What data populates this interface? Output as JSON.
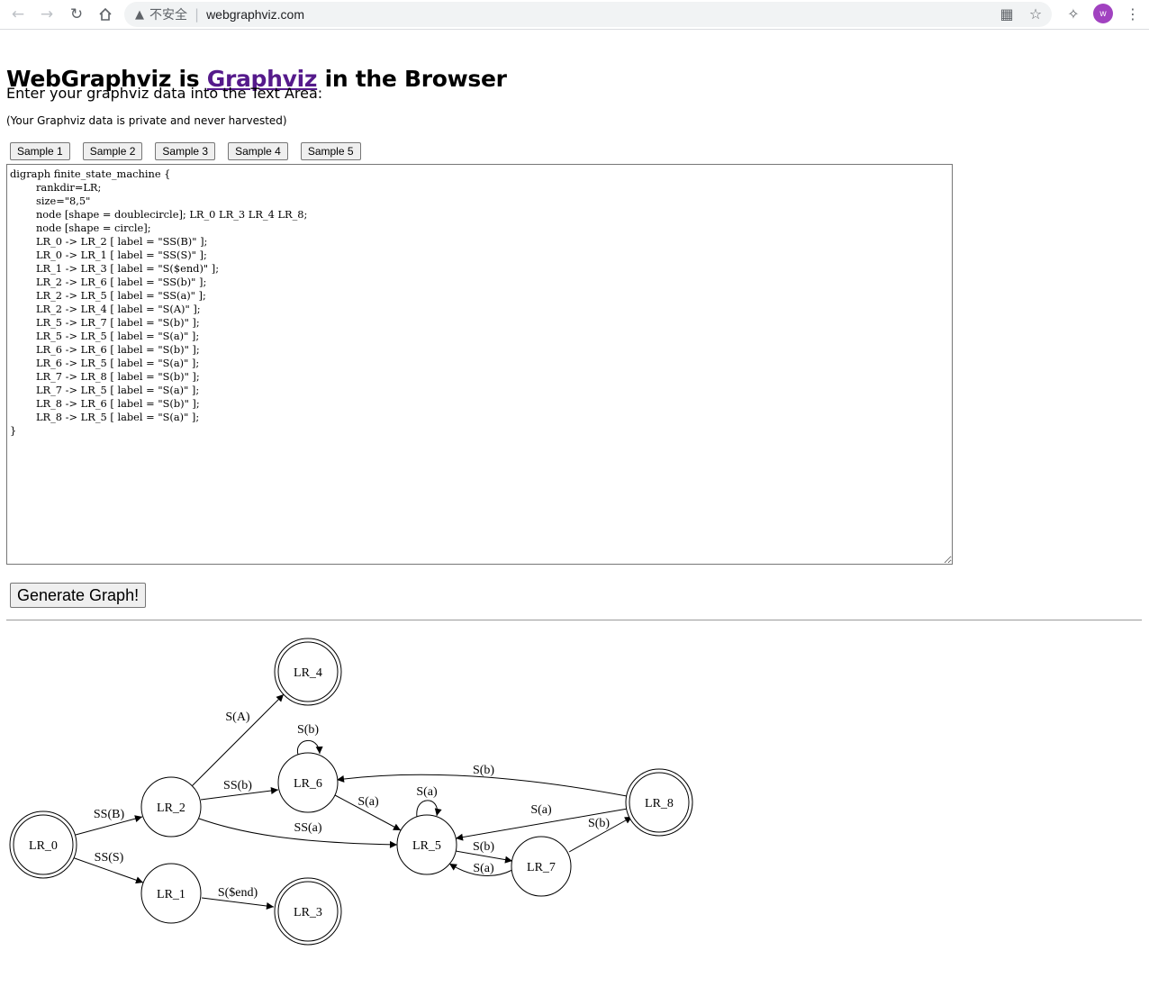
{
  "browser": {
    "insecure_label": "不安全",
    "url": "webgraphviz.com",
    "avatar_letter": "w"
  },
  "header": {
    "title_prefix": "WebGraphviz is ",
    "title_link": "Graphviz",
    "title_suffix": " in the Browser"
  },
  "intro_text": "Enter your graphviz data into the Text Area:",
  "privacy_text": "(Your Graphviz data is private and never harvested)",
  "samples": [
    "Sample 1",
    "Sample 2",
    "Sample 3",
    "Sample 4",
    "Sample 5"
  ],
  "editor": {
    "content": "digraph finite_state_machine {\n\trankdir=LR;\n\tsize=\"8,5\"\n\tnode [shape = doublecircle]; LR_0 LR_3 LR_4 LR_8;\n\tnode [shape = circle];\n\tLR_0 -> LR_2 [ label = \"SS(B)\" ];\n\tLR_0 -> LR_1 [ label = \"SS(S)\" ];\n\tLR_1 -> LR_3 [ label = \"S($end)\" ];\n\tLR_2 -> LR_6 [ label = \"SS(b)\" ];\n\tLR_2 -> LR_5 [ label = \"SS(a)\" ];\n\tLR_2 -> LR_4 [ label = \"S(A)\" ];\n\tLR_5 -> LR_7 [ label = \"S(b)\" ];\n\tLR_5 -> LR_5 [ label = \"S(a)\" ];\n\tLR_6 -> LR_6 [ label = \"S(b)\" ];\n\tLR_6 -> LR_5 [ label = \"S(a)\" ];\n\tLR_7 -> LR_8 [ label = \"S(b)\" ];\n\tLR_7 -> LR_5 [ label = \"S(a)\" ];\n\tLR_8 -> LR_6 [ label = \"S(b)\" ];\n\tLR_8 -> LR_5 [ label = \"S(a)\" ];\n}"
  },
  "generate_button": "Generate Graph!",
  "graph": {
    "nodes": {
      "LR_0": "LR_0",
      "LR_1": "LR_1",
      "LR_2": "LR_2",
      "LR_3": "LR_3",
      "LR_4": "LR_4",
      "LR_5": "LR_5",
      "LR_6": "LR_6",
      "LR_7": "LR_7",
      "LR_8": "LR_8"
    },
    "edge_labels": {
      "e0_2": "SS(B)",
      "e0_1": "SS(S)",
      "e1_3": "S($end)",
      "e2_6": "SS(b)",
      "e2_5": "SS(a)",
      "e2_4": "S(A)",
      "e5_7": "S(b)",
      "e5_5": "S(a)",
      "e6_6": "S(b)",
      "e6_5": "S(a)",
      "e7_8": "S(b)",
      "e7_5": "S(a)",
      "e8_6": "S(b)",
      "e8_5": "S(a)"
    }
  }
}
